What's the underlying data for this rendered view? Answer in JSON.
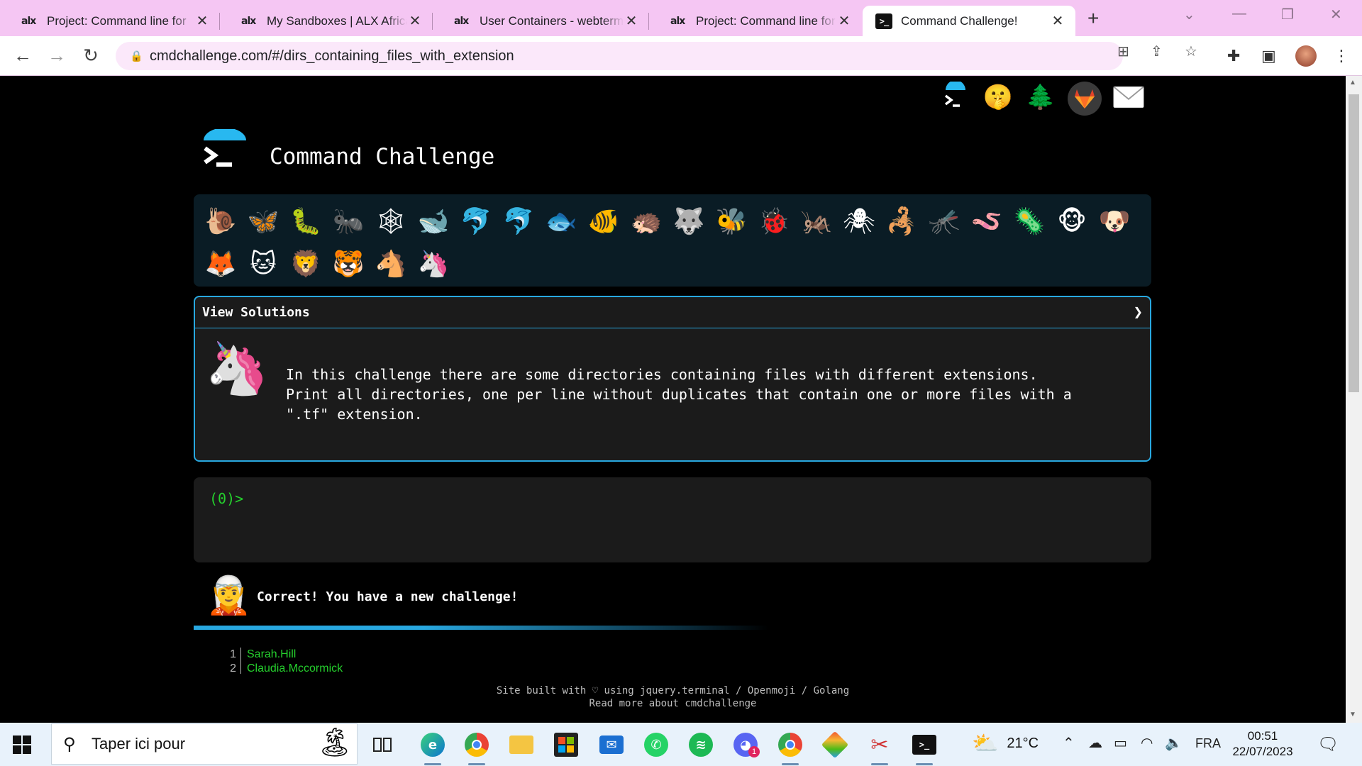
{
  "browser": {
    "tabs": [
      {
        "favicon": "alx",
        "title": "Project: Command line for",
        "close": "✕"
      },
      {
        "favicon": "alx",
        "title": "My Sandboxes | ALX Africa",
        "close": "✕"
      },
      {
        "favicon": "alx",
        "title": "User Containers - webterm",
        "close": "✕"
      },
      {
        "favicon": "alx",
        "title": "Project: Command line for",
        "close": "✕"
      },
      {
        "favicon": ">_",
        "title": "Command Challenge!",
        "close": "✕"
      }
    ],
    "new_tab": "+",
    "url": "cmdchallenge.com/#/dirs_containing_files_with_extension"
  },
  "page": {
    "top_icons": [
      "terminal-icon",
      "shushing-face-icon",
      "tree-icon",
      "gitlab-icon",
      "envelope-icon"
    ],
    "title": "Command Challenge",
    "animals": [
      "🐌",
      "🦋",
      "🐛",
      "🐜",
      "🕸",
      "🐋",
      "🐬",
      "🐬",
      "🐟",
      "🐠",
      "🦔",
      "🐺",
      "🐝",
      "🐞",
      "🦗",
      "🕷",
      "🦂",
      "🦟",
      "🪱",
      "🦠",
      "🐵",
      "🐶",
      "🦊",
      "🐱",
      "🦁",
      "🐯",
      "🐴",
      "🦄"
    ],
    "solutions_label": "View Solutions",
    "solutions_chevron": "❯",
    "challenge_avatar": "🦄",
    "challenge_text": "In this challenge there are some directories containing files with different extensions.\nPrint all directories, one per line without duplicates that contain one or more files with a\n\".tf\" extension.",
    "prompt": "(0)>",
    "result_avatar": "🧝",
    "result_text": "Correct! You have a new challenge!",
    "output": [
      {
        "num": "1",
        "value": "Sarah.Hill"
      },
      {
        "num": "2",
        "value": "Claudia.Mccormick"
      }
    ],
    "footer_line1": "Site built with ♡ using jquery.terminal / Openmoji / Golang",
    "footer_line2": "Read more about cmdchallenge"
  },
  "taskbar": {
    "search_placeholder": "Taper ici pour",
    "temperature": "21°C",
    "language": "FRA",
    "time": "00:51",
    "date": "22/07/2023",
    "discord_badge": "1"
  },
  "colors": {
    "accent": "#28a8e0",
    "terminal_green": "#25d02d",
    "chrome_tab_bar": "#f5c6f3"
  }
}
